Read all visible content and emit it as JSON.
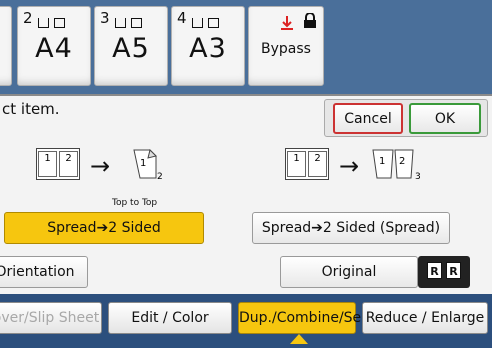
{
  "trays": [
    {
      "num": "2",
      "paper": "A4"
    },
    {
      "num": "3",
      "paper": "A5"
    },
    {
      "num": "4",
      "paper": "A3"
    }
  ],
  "bypass": {
    "label": "Bypass"
  },
  "dialog": {
    "instruction": "ct item.",
    "cancel_label": "Cancel",
    "ok_label": "OK"
  },
  "diagram_left": {
    "p1": "1",
    "p2": "2",
    "sub": "2",
    "caption": "Top to Top"
  },
  "diagram_right": {
    "p1": "1",
    "p2": "2",
    "sub": "3"
  },
  "options": {
    "spread_2sided": "Spread➔2 Sided",
    "spread_2sided_spread": "Spread➔2 Sided (Spread)",
    "orientation_left": "Orientation",
    "original_orientation": "Original Orientation",
    "orientation_icon_letter": "R"
  },
  "tabs": [
    {
      "label": "over/Slip Sheet",
      "state": "dim"
    },
    {
      "label": "Edit / Color",
      "state": "normal"
    },
    {
      "label": "Dup./Combine/Series",
      "state": "active"
    },
    {
      "label": "Reduce / Enlarge",
      "state": "normal"
    }
  ],
  "colors": {
    "accent": "#f6c60f",
    "cancel_border": "#cc3333",
    "ok_border": "#3a9a3a"
  }
}
